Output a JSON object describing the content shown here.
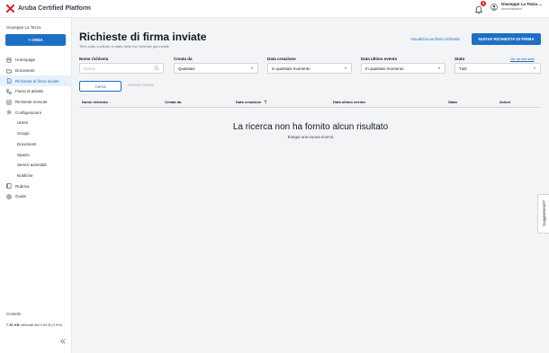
{
  "app": {
    "title": "Aruba Certified Platform"
  },
  "header": {
    "notifications_count": "4",
    "user_name": "Giuseppe La Tezza ...",
    "user_role": "Amministratore"
  },
  "sidebar": {
    "user": "Giuseppe La Tezza",
    "create_label": "+ CREA",
    "items": [
      {
        "label": "Homepage",
        "icon": "home-icon"
      },
      {
        "label": "Documenti",
        "icon": "folder-icon"
      },
      {
        "label": "Richieste di firma inviate",
        "icon": "document-sign-icon"
      },
      {
        "label": "Flussi di attività",
        "icon": "flow-icon"
      },
      {
        "label": "Richieste ricevute",
        "icon": "inbox-icon"
      },
      {
        "label": "Configurazioni",
        "icon": "gear-icon"
      },
      {
        "label": "Utenti"
      },
      {
        "label": "Gruppi"
      },
      {
        "label": "Documenti"
      },
      {
        "label": "Spazio"
      },
      {
        "label": "Servizi aziendali"
      },
      {
        "label": "Notifiche"
      },
      {
        "label": "Rubrica",
        "icon": "address-book-icon"
      },
      {
        "label": "Guide",
        "icon": "help-icon"
      }
    ],
    "bottom_title": "Cestello",
    "usage_value": "7.51 KB",
    "usage_text": "utilizzati del 0.00 B (0.0%)"
  },
  "main": {
    "title": "Richieste di firma inviate",
    "subtitle": "Tieni sotto controllo lo stato delle tue richieste già inviate",
    "archive_link": "Visualizza archivio richieste",
    "new_request_button": "NUOVA RICHIESTA DI FIRMA",
    "filters": {
      "name_label": "Nome richiesta",
      "name_placeholder": "Cerca...",
      "created_by_label": "Creata da",
      "created_by_value": "Qualsiasi",
      "created_date_label": "Data creazione",
      "created_date_value": "In qualsiasi momento",
      "last_event_label": "Data ultimo evento",
      "last_event_value": "In qualsiasi momento",
      "status_label": "Stato",
      "status_value": "Tutti",
      "reset_link": "Ge da soli stati"
    },
    "search_button": "Cerca",
    "reset_button": "Azzera ricerca",
    "table_columns": [
      "Nome richiesta",
      "Creata da",
      "Data creazione",
      "Data ultimo evento",
      "Stato",
      "Azioni"
    ],
    "empty_title": "La ricerca non ha fornito alcun risultato",
    "empty_subtitle": "Esegui una nuova ricerca"
  },
  "feedback": {
    "label": "Suggerimenti?"
  },
  "colors": {
    "accent": "#1d6fc4",
    "badge": "#dc2626",
    "brand_red": "#d61f26"
  }
}
